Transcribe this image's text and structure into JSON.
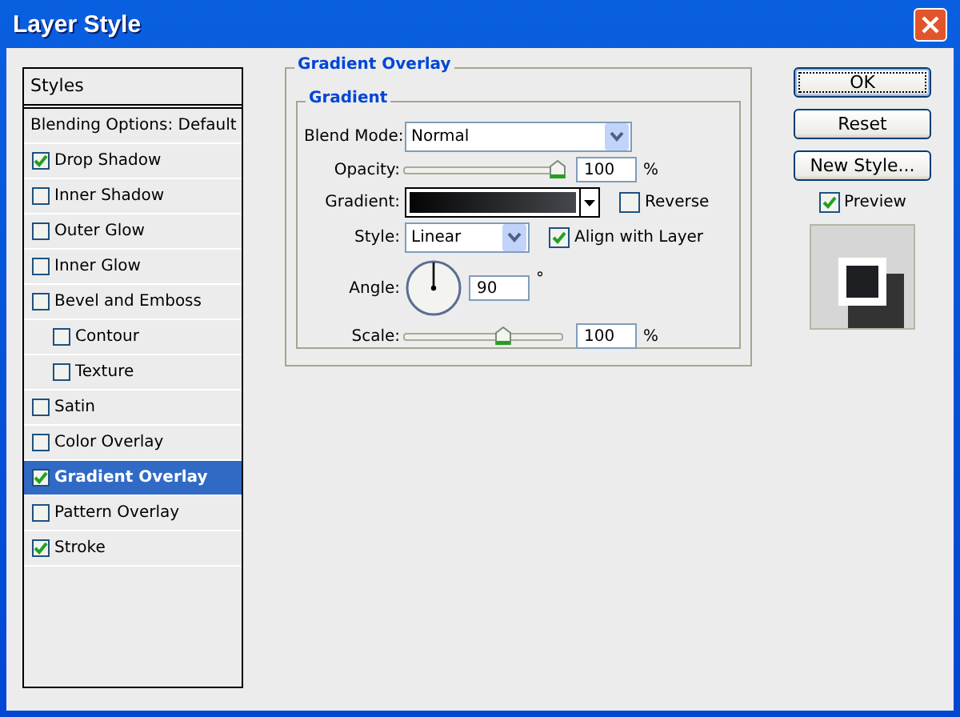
{
  "window": {
    "title": "Layer Style"
  },
  "styles_list": {
    "header": "Styles",
    "blending": "Blending Options: Default",
    "items": [
      {
        "label": "Drop Shadow",
        "checked": true,
        "selected": false
      },
      {
        "label": "Inner Shadow",
        "checked": false,
        "selected": false
      },
      {
        "label": "Outer Glow",
        "checked": false,
        "selected": false
      },
      {
        "label": "Inner Glow",
        "checked": false,
        "selected": false
      },
      {
        "label": "Bevel and Emboss",
        "checked": false,
        "selected": false,
        "children": [
          {
            "label": "Contour",
            "checked": false,
            "selected": false
          },
          {
            "label": "Texture",
            "checked": false,
            "selected": false
          }
        ]
      },
      {
        "label": "Satin",
        "checked": false,
        "selected": false
      },
      {
        "label": "Color Overlay",
        "checked": false,
        "selected": false
      },
      {
        "label": "Gradient Overlay",
        "checked": true,
        "selected": true
      },
      {
        "label": "Pattern Overlay",
        "checked": false,
        "selected": false
      },
      {
        "label": "Stroke",
        "checked": true,
        "selected": false
      }
    ]
  },
  "panel": {
    "title": "Gradient Overlay",
    "group": "Gradient",
    "blend_mode": {
      "label": "Blend Mode:",
      "value": "Normal"
    },
    "opacity": {
      "label": "Opacity:",
      "level": 1.0,
      "value": "100",
      "unit": "%"
    },
    "gradient": {
      "label": "Gradient:",
      "reverse": {
        "label": "Reverse",
        "checked": false
      }
    },
    "style": {
      "label": "Style:",
      "value": "Linear",
      "align": {
        "label": "Align with Layer",
        "checked": true
      }
    },
    "angle": {
      "label": "Angle:",
      "value": "90",
      "unit": "°"
    },
    "scale": {
      "label": "Scale:",
      "level": 0.63,
      "value": "100",
      "unit": "%"
    }
  },
  "buttons": [
    {
      "label": "OK",
      "default": true
    },
    {
      "label": "Reset",
      "default": false
    },
    {
      "label": "New Style...",
      "default": false
    }
  ],
  "preview": {
    "label": "Preview",
    "checked": true
  }
}
